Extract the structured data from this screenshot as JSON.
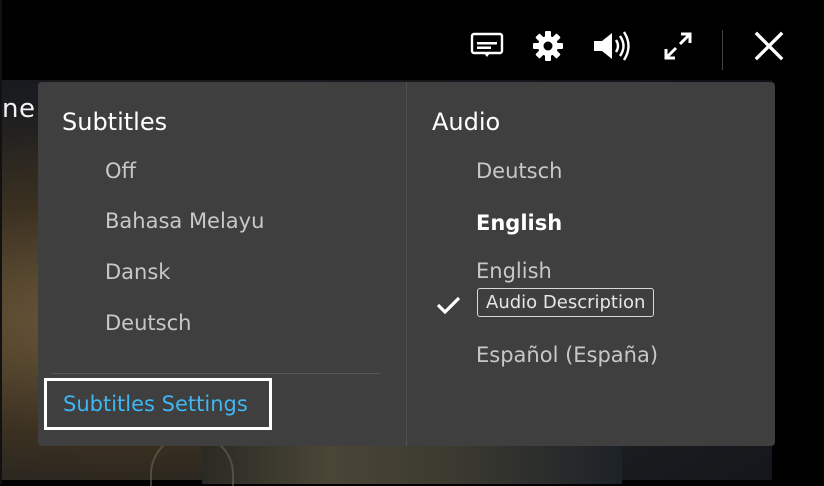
{
  "video": {
    "partial_text": "ne"
  },
  "controls": {
    "subtitles_icon": "subtitles-icon",
    "settings_icon": "gear-icon",
    "volume_icon": "volume-icon",
    "fullscreen_icon": "expand-icon",
    "close_icon": "close-icon"
  },
  "subtitles": {
    "title": "Subtitles",
    "items": [
      "Off",
      "Bahasa Melayu",
      "Dansk",
      "Deutsch"
    ],
    "settings_label": "Subtitles Settings"
  },
  "audio": {
    "title": "Audio",
    "items": [
      {
        "label": "Deutsch",
        "selected": false
      },
      {
        "label": "English",
        "selected": true
      },
      {
        "label": "English",
        "badge": "Audio Description",
        "selected": false
      },
      {
        "label": "Español (España)",
        "selected": false
      }
    ]
  },
  "colors": {
    "panel_bg": "#3f3f3f",
    "link": "#3fb6f2",
    "text": "#c8c8c8",
    "selected_text": "#ffffff"
  }
}
